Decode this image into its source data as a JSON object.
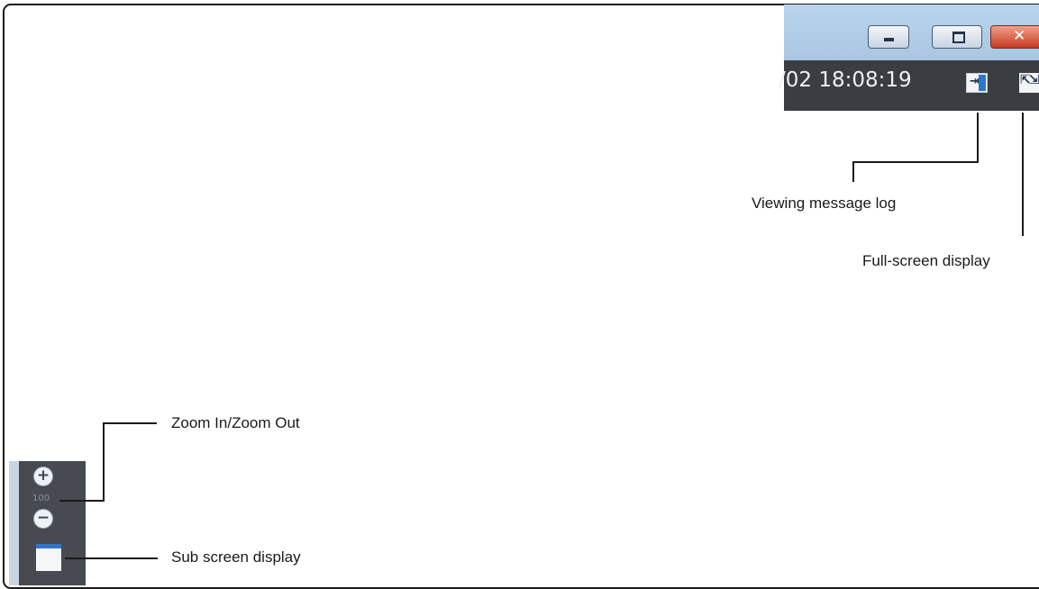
{
  "window": {
    "timestamp": "/02 18:08:19",
    "buttons": {
      "minimize_icon": "minimize-icon",
      "maximize_icon": "maximize-icon",
      "close_icon": "close-icon",
      "close_symbol": "✕"
    },
    "toolbar_icons": {
      "message_log": "message-log-icon",
      "full_screen": "full-screen-icon"
    }
  },
  "zoom_panel": {
    "zoom_in_symbol": "+",
    "percent": "100",
    "zoom_out_symbol": "−"
  },
  "callouts": {
    "viewing_message_log": "Viewing message log",
    "full_screen_display": "Full-screen display",
    "zoom_in_out": "Zoom In/Zoom Out",
    "sub_screen_display": "Sub screen display"
  },
  "colors": {
    "title_bar": "#b0cce6",
    "toolbar": "#3a3d42",
    "accent_blue": "#2f76c8",
    "close_red": "#c7391f"
  }
}
